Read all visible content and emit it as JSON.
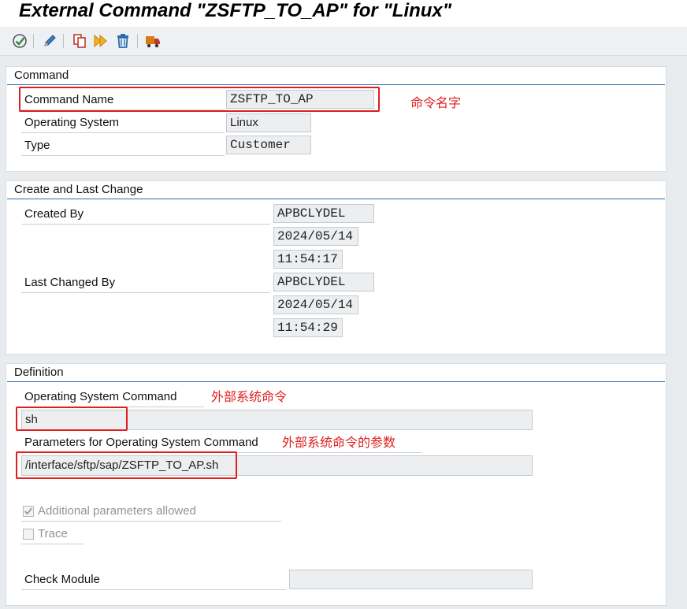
{
  "window": {
    "title": "External Command \"ZSFTP_TO_AP\" for \"Linux\""
  },
  "toolbar": {
    "buttons": [
      {
        "name": "check-icon",
        "color": "#2e8b3d"
      },
      {
        "name": "edit-pencil-icon",
        "color": "#2a6bb0"
      },
      {
        "name": "copy-icon",
        "color": "#c0392b"
      },
      {
        "name": "execute-icon",
        "color": "#e69a1c"
      },
      {
        "name": "delete-trash-icon",
        "color": "#2a6bb0"
      },
      {
        "name": "transport-truck-icon",
        "color": "#d97b14"
      }
    ]
  },
  "command": {
    "section_title": "Command",
    "command_name_label": "Command Name",
    "command_name_value": "ZSFTP_TO_AP",
    "os_label": "Operating System",
    "os_value": "Linux",
    "type_label": "Type",
    "type_value": "Customer",
    "annotation": "命令名字"
  },
  "change": {
    "section_title": "Create and Last Change",
    "created_by_label": "Created By",
    "created_by_user": "APBCLYDEL",
    "created_date": "2024/05/14",
    "created_time": "11:54:17",
    "changed_by_label": "Last Changed By",
    "changed_by_user": "APBCLYDEL",
    "changed_date": "2024/05/14",
    "changed_time": "11:54:29"
  },
  "definition": {
    "section_title": "Definition",
    "os_command_label": "Operating System Command",
    "os_command_value": "sh",
    "os_command_annotation": "外部系统命令",
    "params_label": "Parameters for Operating System Command",
    "params_value": "/interface/sftp/sap/ZSFTP_TO_AP.sh",
    "params_annotation": "外部系统命令的参数",
    "additional_params_label": "Additional parameters allowed",
    "additional_params_checked": true,
    "trace_label": "Trace",
    "trace_checked": false,
    "check_module_label": "Check Module",
    "check_module_value": ""
  },
  "colors": {
    "accent": "#2a6bb0",
    "annotation_red": "#e01e1e",
    "field_bg": "#eceef0"
  }
}
